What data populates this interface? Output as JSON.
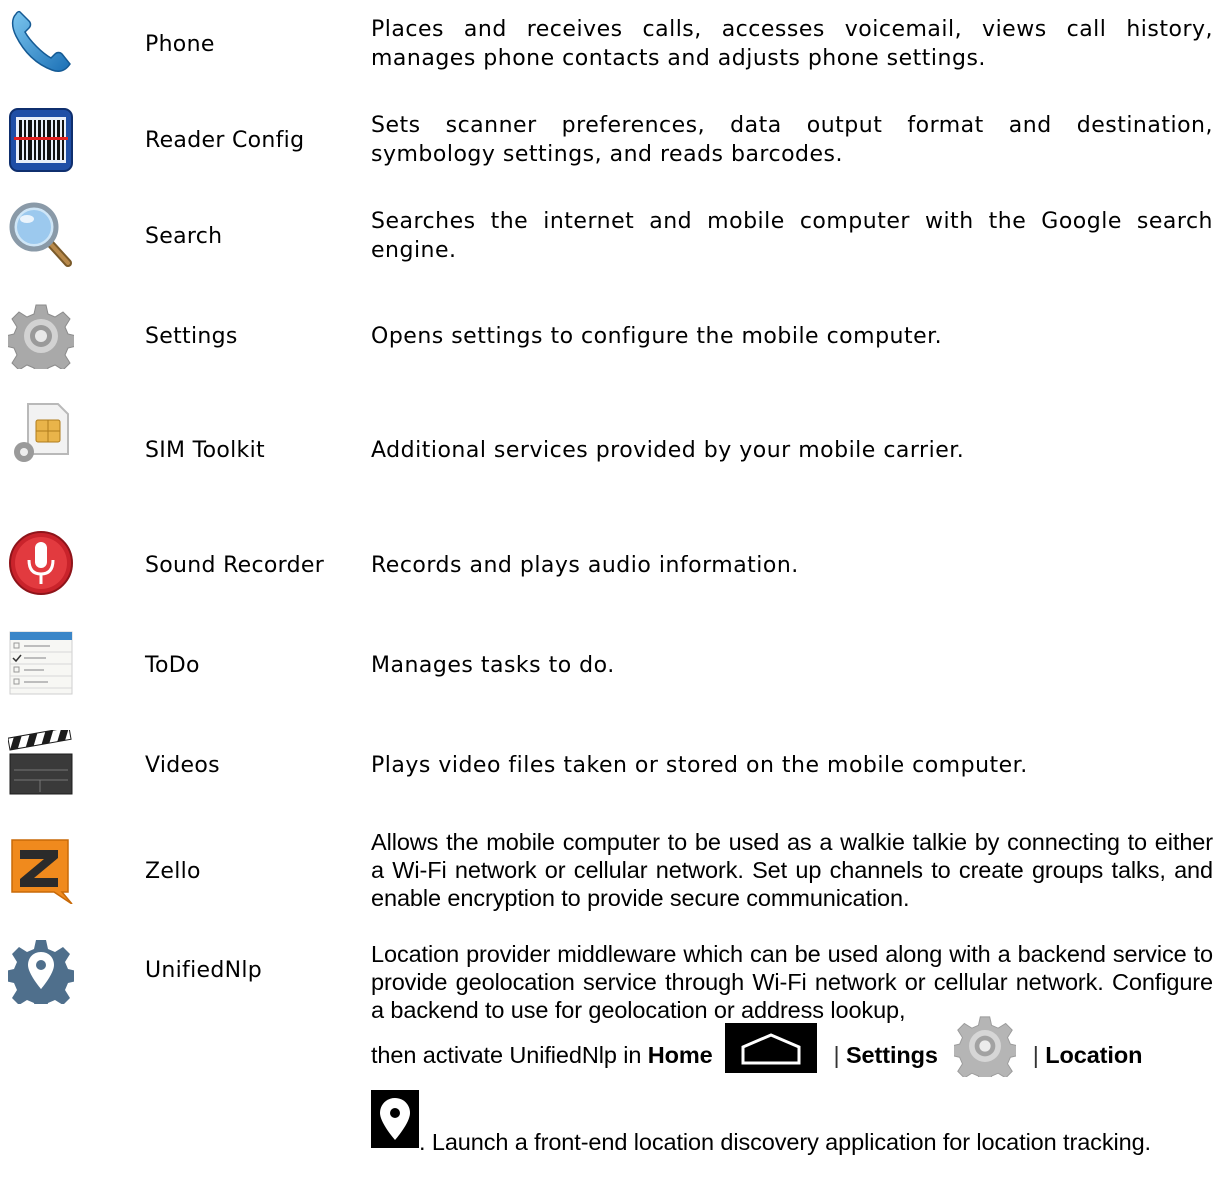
{
  "apps": [
    {
      "icon": "phone-icon",
      "name": "Phone",
      "description": "Places and receives calls, accesses voicemail, views call history, manages phone contacts and adjusts phone settings."
    },
    {
      "icon": "barcode-scanner-icon",
      "name": "Reader Config",
      "description": "Sets scanner preferences, data output format and destination, symbology settings, and reads barcodes."
    },
    {
      "icon": "magnifier-icon",
      "name": "Search",
      "description": "Searches the internet and mobile computer with the Google search engine."
    },
    {
      "icon": "gear-icon",
      "name": "Settings",
      "description": "Opens settings to configure the mobile computer."
    },
    {
      "icon": "sim-card-icon",
      "name": "SIM Toolkit",
      "description": "Additional services provided by your mobile carrier."
    },
    {
      "icon": "microphone-icon",
      "name": "Sound Recorder",
      "description": "Records and plays audio information."
    },
    {
      "icon": "todo-list-icon",
      "name": "ToDo",
      "description": "Manages tasks to do."
    },
    {
      "icon": "clapperboard-icon",
      "name": "Videos",
      "description": "Plays video files taken or stored on the mobile computer."
    },
    {
      "icon": "zello-logo-icon",
      "name": "Zello",
      "description": "Allows the mobile computer to be used as a walkie talkie by connecting to either a Wi-Fi network or cellular network. Set up channels to create groups talks, and enable encryption to provide secure communication."
    },
    {
      "icon": "location-gear-icon",
      "name": "UnifiedNlp",
      "description_part1": "Location provider middleware which can be used along with a backend service to provide geolocation service through Wi-Fi network or cellular network. Configure a backend to use for geolocation or address lookup,",
      "description_part2": "then activate UnifiedNlp in",
      "home_label": "Home",
      "sep1": "|",
      "settings_label": "Settings",
      "sep2": "|",
      "location_label": "Location",
      "description_part3": ". Launch a front-end location discovery application for location tracking."
    }
  ]
}
